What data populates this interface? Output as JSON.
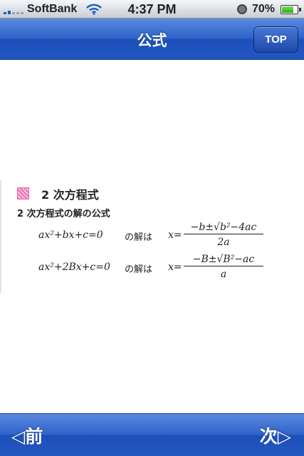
{
  "status_bar": {
    "carrier": "SoftBank",
    "time": "4:37 PM",
    "battery_percent": "70%",
    "battery_level": 0.7
  },
  "nav": {
    "title": "公式",
    "top_button_label": "TOP"
  },
  "content": {
    "section_title": "2 次方程式",
    "subtitle": "2 次方程式の解の公式",
    "accent_color": "#ee6fb3",
    "formulas": [
      {
        "equation": "ax²+bx+c=0",
        "connector": "の解は",
        "lhs": "x=",
        "numerator": "−b±√b²−4ac",
        "denominator": "2a"
      },
      {
        "equation": "ax²+2Bx+c=0",
        "connector": "の解は",
        "lhs": "x=",
        "numerator": "−B±√B²−ac",
        "denominator": "a"
      }
    ]
  },
  "toolbar": {
    "prev_label": "◁前",
    "next_label": "次▷"
  },
  "colors": {
    "nav_blue": "#2f63c9",
    "status_bar": "#c9ced4"
  }
}
